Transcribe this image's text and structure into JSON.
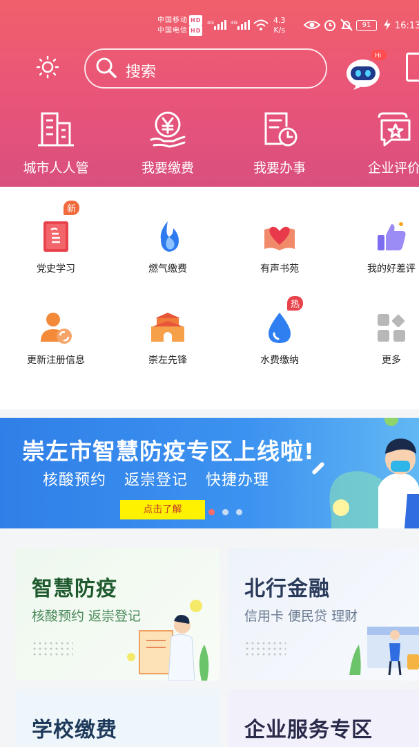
{
  "status_bar": {
    "carrier1": "中国移动",
    "carrier2": "中国电信",
    "hd": "HD",
    "net1": "4G",
    "net2": "4G",
    "speed_value": "4.3",
    "speed_unit": "K/s",
    "battery": "91",
    "time": "16:13"
  },
  "search": {
    "placeholder": "搜索",
    "hi_badge": "Hi"
  },
  "quick_actions": [
    {
      "label": "城市人人管",
      "icon": "building-icon"
    },
    {
      "label": "我要缴费",
      "icon": "yen-hand-icon"
    },
    {
      "label": "我要办事",
      "icon": "document-clock-icon"
    },
    {
      "label": "企业评价",
      "icon": "chat-star-icon"
    }
  ],
  "services": [
    {
      "label": "党史学习",
      "icon": "party-book-icon",
      "badge": "新"
    },
    {
      "label": "燃气缴费",
      "icon": "flame-icon"
    },
    {
      "label": "有声书苑",
      "icon": "audio-book-icon"
    },
    {
      "label": "我的好差评",
      "icon": "thumbs-up-icon"
    },
    {
      "label": "更新注册信息",
      "icon": "user-refresh-icon"
    },
    {
      "label": "崇左先锋",
      "icon": "gate-tower-icon"
    },
    {
      "label": "水费缴纳",
      "icon": "water-drop-icon",
      "badge": "热"
    },
    {
      "label": "更多",
      "icon": "more-grid-icon"
    }
  ],
  "banner": {
    "title": "崇左市智慧防疫专区上线啦!",
    "subtitle": "核酸预约  返崇登记  快捷办理",
    "button": "点击了解"
  },
  "cards": [
    {
      "title": "智慧防疫",
      "subtitle": "核酸预约 返崇登记"
    },
    {
      "title": "北行金融",
      "subtitle": "信用卡 便民贷 理财"
    },
    {
      "title": "学校缴费",
      "subtitle": ""
    },
    {
      "title": "企业服务专区",
      "subtitle": ""
    }
  ],
  "colors": {
    "header_top": "#f0606b",
    "header_bottom": "#d94f7e",
    "banner_blue": "#2f7fe8",
    "badge_orange": "#f06a3c"
  }
}
